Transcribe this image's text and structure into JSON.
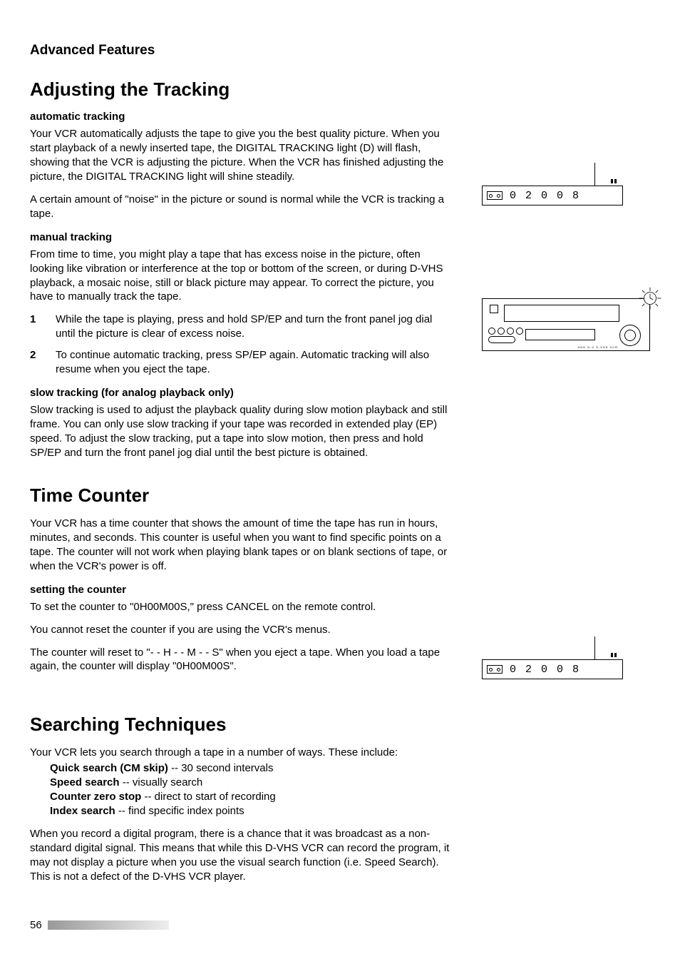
{
  "chapter": "Advanced Features",
  "sec1": {
    "title": "Adjusting the Tracking",
    "auto_head": "automatic tracking",
    "auto_p1": "Your VCR automatically adjusts the tape to give you the best quality picture.  When you start playback of a newly inserted tape, the DIGITAL TRACKING light (D) will flash, showing that the VCR is adjusting the picture.  When the VCR has finished adjusting the picture, the DIGITAL TRACKING light will shine steadily.",
    "auto_p2": "A certain amount of \"noise\" in the picture or sound is normal while the VCR is tracking a tape.",
    "manual_head": "manual tracking",
    "manual_p1": "From time to time, you might play a tape that has excess noise in the picture, often looking like vibration or interference at the top or bottom of the screen, or during D-VHS playback, a mosaic noise, still or black picture may appear.  To correct the picture, you have to manually track the tape.",
    "step1_num": "1",
    "step1": "While the tape is playing, press and hold SP/EP and turn the front panel jog dial until the picture is clear of excess noise.",
    "step2_num": "2",
    "step2": "To continue automatic tracking, press SP/EP again.  Automatic tracking will also resume when you eject the tape.",
    "slow_head": "slow tracking (for analog playback only)",
    "slow_p1": "Slow tracking is used to adjust the playback quality during slow motion playback and still frame.  You can only use slow tracking if your tape was recorded in extended play (EP) speed.  To adjust the slow tracking, put a tape into slow motion, then press and hold SP/EP and turn the front panel jog dial until the best picture is obtained."
  },
  "sec2": {
    "title": "Time Counter",
    "p1": "Your VCR has a time counter that shows the amount of time the tape has run in hours, minutes, and seconds.  This counter is useful when you want to find specific points on a tape.  The counter will not work when playing blank tapes or on blank sections of tape, or when the VCR's power is off.",
    "set_head": "setting the counter",
    "p2": "To set the counter to \"0H00M00S,\" press CANCEL on the remote control.",
    "p3": "You cannot reset the counter if you are using the VCR's menus.",
    "p4": "The counter will reset to \"- - H - - M - - S\" when you eject a tape.  When you load a tape again, the counter will display \"0H00M00S\"."
  },
  "sec3": {
    "title": "Searching Techniques",
    "intro": "Your VCR lets you search through a tape in a number of ways.  These include:",
    "l1b": "Quick search (CM skip)",
    "l1r": " -- 30 second intervals",
    "l2b": "Speed search",
    "l2r": " -- visually search",
    "l3b": "Counter zero stop",
    "l3r": " -- direct to start of recording",
    "l4b": "Index search",
    "l4r": " -- find specific index points",
    "p2": "When you record a digital program, there is a chance that it was broadcast as a non-standard digital signal.  This means that while this D-VHS VCR can record the program, it may not display a picture when you use the visual search function (i.e. Speed Search).  This is not a defect of the D-VHS VCR player."
  },
  "display": {
    "value": "0 2 0 0 8"
  },
  "page_number": "56"
}
